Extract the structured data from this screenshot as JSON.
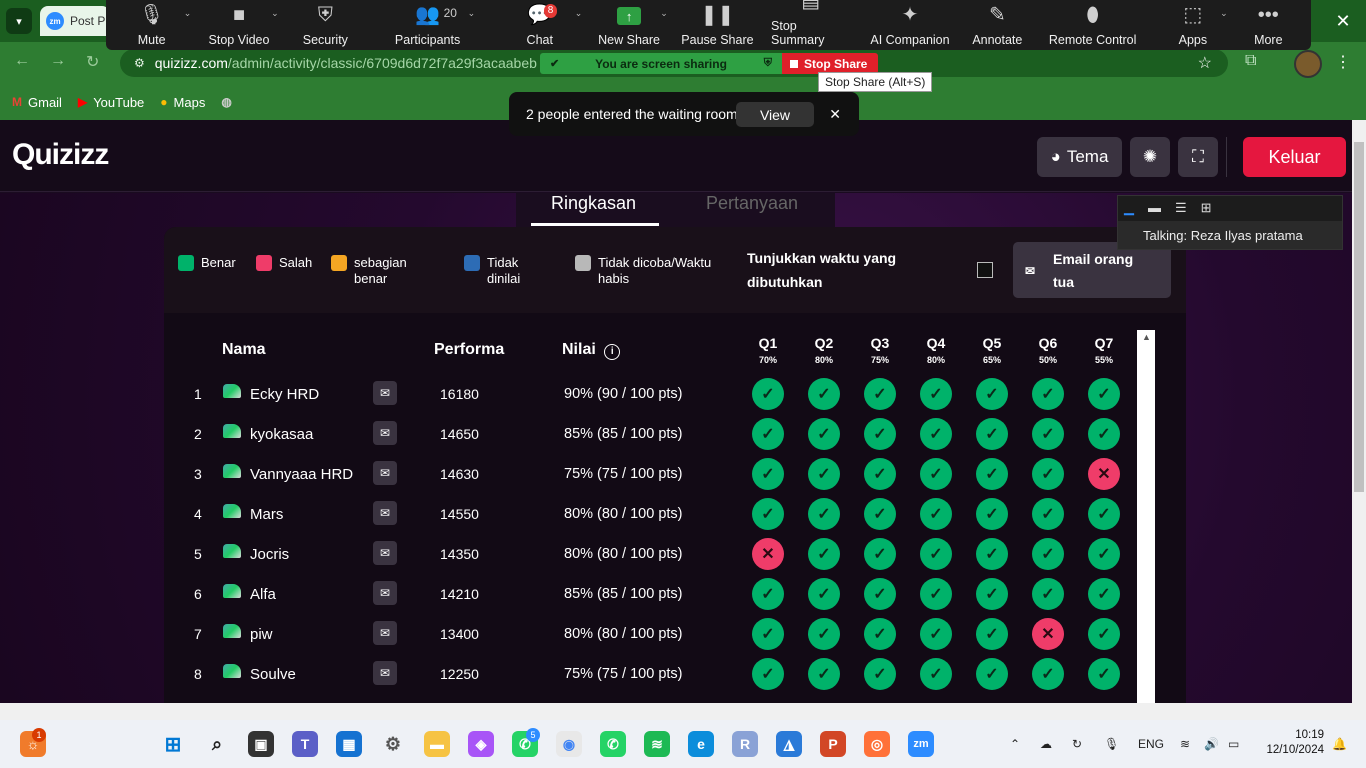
{
  "browser": {
    "tab_title": "Post P",
    "url_domain": "quizizz.com",
    "url_path": "/admin/activity/classic/6709d6d72f7a29f3acaabeb",
    "bookmarks": [
      "Gmail",
      "YouTube",
      "Maps"
    ]
  },
  "zoom_toolbar": {
    "buttons": [
      {
        "label": "Mute",
        "icon": "microphone-icon"
      },
      {
        "label": "Stop Video",
        "icon": "video-camera-icon"
      },
      {
        "label": "Security",
        "icon": "shield-icon"
      },
      {
        "label": "Participants",
        "icon": "participants-icon",
        "count": "20"
      },
      {
        "label": "Chat",
        "icon": "chat-icon",
        "badge": "8"
      },
      {
        "label": "New Share",
        "icon": "share-arrow-icon"
      },
      {
        "label": "Pause Share",
        "icon": "pause-icon"
      },
      {
        "label": "Stop Summary",
        "icon": "summary-icon"
      },
      {
        "label": "AI Companion",
        "icon": "sparkle-icon"
      },
      {
        "label": "Annotate",
        "icon": "pencil-icon"
      },
      {
        "label": "Remote Control",
        "icon": "mouse-icon"
      },
      {
        "label": "Apps",
        "icon": "apps-icon"
      },
      {
        "label": "More",
        "icon": "ellipsis-icon"
      }
    ],
    "sharing_banner": "You are screen sharing",
    "stop_share": "Stop Share",
    "stop_share_tooltip": "Stop Share (Alt+S)"
  },
  "waiting_room": {
    "message": "2 people entered the waiting room",
    "view_label": "View"
  },
  "zoom_panel": {
    "talking": "Talking: Reza Ilyas pratama"
  },
  "quizizz": {
    "logo": "Quizizz",
    "theme_label": "Tema",
    "exit_label": "Keluar",
    "tabs": [
      "Ringkasan",
      "Pertanyaan"
    ],
    "legend": [
      {
        "label": "Benar",
        "color": "#00b26a"
      },
      {
        "label": "Salah",
        "color": "#ef3c69"
      },
      {
        "label": "sebagian benar",
        "color": "#f5a623"
      },
      {
        "label": "Tidak dinilai",
        "color": "#2d6cb5"
      },
      {
        "label": "Tidak dicoba/Waktu habis",
        "color": "#b8b8b8"
      }
    ],
    "show_time_label": "Tunjukkan waktu yang dibutuhkan",
    "email_parents_label": "Email orang tua",
    "columns": {
      "name": "Nama",
      "performance": "Performa",
      "score": "Nilai"
    },
    "questions": [
      {
        "q": "Q1",
        "pct": "70%"
      },
      {
        "q": "Q2",
        "pct": "80%"
      },
      {
        "q": "Q3",
        "pct": "75%"
      },
      {
        "q": "Q4",
        "pct": "80%"
      },
      {
        "q": "Q5",
        "pct": "65%"
      },
      {
        "q": "Q6",
        "pct": "50%"
      },
      {
        "q": "Q7",
        "pct": "55%"
      }
    ],
    "rows": [
      {
        "rank": "1",
        "name": "Ecky HRD",
        "performance": "16180",
        "score": "90% (90 / 100 pts)",
        "answers": [
          "c",
          "c",
          "c",
          "c",
          "c",
          "c",
          "c"
        ]
      },
      {
        "rank": "2",
        "name": "kyokasaa",
        "performance": "14650",
        "score": "85% (85 / 100 pts)",
        "answers": [
          "c",
          "c",
          "c",
          "c",
          "c",
          "c",
          "c"
        ]
      },
      {
        "rank": "3",
        "name": "Vannyaaa HRD",
        "performance": "14630",
        "score": "75% (75 / 100 pts)",
        "answers": [
          "c",
          "c",
          "c",
          "c",
          "c",
          "c",
          "w"
        ]
      },
      {
        "rank": "4",
        "name": "Mars",
        "performance": "14550",
        "score": "80% (80 / 100 pts)",
        "answers": [
          "c",
          "c",
          "c",
          "c",
          "c",
          "c",
          "c"
        ]
      },
      {
        "rank": "5",
        "name": "Jocris",
        "performance": "14350",
        "score": "80% (80 / 100 pts)",
        "answers": [
          "w",
          "c",
          "c",
          "c",
          "c",
          "c",
          "c"
        ]
      },
      {
        "rank": "6",
        "name": "Alfa",
        "performance": "14210",
        "score": "85% (85 / 100 pts)",
        "answers": [
          "c",
          "c",
          "c",
          "c",
          "c",
          "c",
          "c"
        ]
      },
      {
        "rank": "7",
        "name": "piw",
        "performance": "13400",
        "score": "80% (80 / 100 pts)",
        "answers": [
          "c",
          "c",
          "c",
          "c",
          "c",
          "w",
          "c"
        ]
      },
      {
        "rank": "8",
        "name": "Soulve",
        "performance": "12250",
        "score": "75% (75 / 100 pts)",
        "answers": [
          "c",
          "c",
          "c",
          "c",
          "c",
          "c",
          "c"
        ]
      }
    ]
  },
  "taskbar": {
    "language": "ENG",
    "time": "10:19",
    "date": "12/10/2024",
    "badges": {
      "widgets": "1",
      "whatsapp": "5"
    }
  }
}
